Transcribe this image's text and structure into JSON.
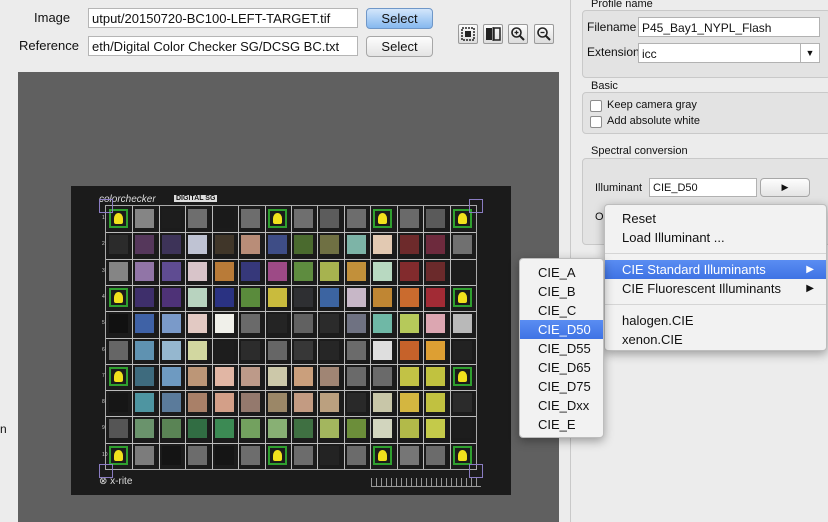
{
  "image_row": {
    "label": "Image",
    "path": "utput/20150720-BC100-LEFT-TARGET.tif",
    "button": "Select"
  },
  "reference_row": {
    "label": "Reference",
    "path": "eth/Digital Color Checker SG/DCSG BC.txt",
    "button": "Select"
  },
  "toolbar": {
    "icons": [
      "fit-icon",
      "compare-icon",
      "zoom-in-icon",
      "zoom-out-icon"
    ]
  },
  "chart": {
    "brand": "colorchecker",
    "brand_badge": "DIGITAL SG",
    "footer_brand": "x-rite",
    "row_numbers": [
      "1",
      "2",
      "3",
      "4",
      "5",
      "6",
      "7",
      "8",
      "9",
      "10"
    ],
    "swatches": [
      [
        "#777777",
        "#858585",
        "#1d1d1d",
        "#6e6e6e",
        "#1a1a1a",
        "#6d6d6d",
        "#1a1a1a",
        "#6f6f6f",
        "#5c5c5c",
        "#6d6d6d",
        "#1b1b1b",
        "#6a6a6a",
        "#5a5a5a",
        "#6f6f6f"
      ],
      [
        "#2b2b2b",
        "#55375b",
        "#3d3358",
        "#bfc3d3",
        "#403629",
        "#b98d78",
        "#3e4d86",
        "#4a6a2e",
        "#6f7043",
        "#7db4a7",
        "#e2c9b2",
        "#6d2a2b",
        "#6d2a3d",
        "#707070"
      ],
      [
        "#858585",
        "#9175a7",
        "#5f4c92",
        "#d8c4c9",
        "#b97b38",
        "#36387a",
        "#9d4a86",
        "#5e8c3f",
        "#a7b34f",
        "#c2903a",
        "#b8d9c1",
        "#822b2d",
        "#6b2a2b",
        "#1c1c1c"
      ],
      [
        "#222222",
        "#3e2f6b",
        "#4e3277",
        "#b8d3bf",
        "#2a3282",
        "#5a8b3c",
        "#c9bb3d",
        "#2e2f32",
        "#3c64a1",
        "#c7b7c7",
        "#c08633",
        "#ca6b2e",
        "#a22b35",
        "#222222"
      ],
      [
        "#111111",
        "#3f62a6",
        "#7a9ac9",
        "#e2c9c3",
        "#f0f0ea",
        "#6a6a6a",
        "#242424",
        "#616161",
        "#2b2b2b",
        "#6f7282",
        "#6fb8a6",
        "#b6c95a",
        "#dca6b1",
        "#b9b9b9"
      ],
      [
        "#666666",
        "#5f92b1",
        "#95b7cf",
        "#d2d7a0",
        "#1d1d1d",
        "#2c2c2c",
        "#666666",
        "#373737",
        "#262626",
        "#6b6b6b",
        "#dedede",
        "#c6622a",
        "#dd9f33",
        "#222222"
      ],
      [
        "#353535",
        "#3e6b7e",
        "#6e9ac1",
        "#bc9677",
        "#e1b6a4",
        "#bd9a89",
        "#ccc8a9",
        "#ca9f7c",
        "#a08574",
        "#6a6a6a",
        "#6a6a6a",
        "#c2c245",
        "#c1c23f",
        "#6f6f6f"
      ],
      [
        "#161616",
        "#4e95a1",
        "#5b7b9b",
        "#a98068",
        "#d39f88",
        "#94796d",
        "#9b8767",
        "#c39b82",
        "#bba07f",
        "#292929",
        "#c8c6a8",
        "#d4b640",
        "#c1c140",
        "#2b2b2b"
      ],
      [
        "#555555",
        "#6a936c",
        "#5a8455",
        "#316d43",
        "#3c8a54",
        "#73a15f",
        "#88b074",
        "#3f7042",
        "#a3b65e",
        "#6c8e3a",
        "#d2d5be",
        "#b2ba49",
        "#c4ca4a",
        "#1d1d1d"
      ],
      [
        "#4b4b4b",
        "#7c7c7c",
        "#141414",
        "#6c6c6c",
        "#151515",
        "#6d6d6d",
        "#1b1b1b",
        "#6c6c6c",
        "#232323",
        "#6b6b6b",
        "#1a1a1a",
        "#767676",
        "#6b6b6b",
        "#6a6a6a"
      ]
    ],
    "bulb_cells": [
      [
        0,
        0
      ],
      [
        0,
        6
      ],
      [
        0,
        10
      ],
      [
        0,
        13
      ],
      [
        3,
        0
      ],
      [
        3,
        13
      ],
      [
        6,
        0
      ],
      [
        6,
        13
      ],
      [
        9,
        0
      ],
      [
        9,
        6
      ],
      [
        9,
        10
      ],
      [
        9,
        13
      ]
    ]
  },
  "left_edge_letter": "n",
  "panel": {
    "profile_name": {
      "title": "Profile name",
      "filename_label": "Filename",
      "filename_value": "P45_Bay1_NYPL_Flash",
      "extension_label": "Extension",
      "extension_value": "icc"
    },
    "basic": {
      "title": "Basic",
      "keep_gray_label": "Keep camera gray",
      "keep_gray_checked": false,
      "absolute_white_label": "Add absolute white",
      "absolute_white_checked": false
    },
    "spectral": {
      "title": "Spectral conversion",
      "illuminant_label": "Illuminant",
      "illuminant_value": "CIE_D50",
      "partial_label": "O"
    }
  },
  "context_menu": {
    "items": [
      {
        "label": "Reset",
        "submenu": false,
        "highlighted": false
      },
      {
        "label": "Load Illuminant ...",
        "submenu": false,
        "highlighted": false
      },
      {
        "label": "CIE Standard Illuminants",
        "submenu": true,
        "highlighted": true
      },
      {
        "label": "CIE Fluorescent Illuminants",
        "submenu": true,
        "highlighted": false
      },
      {
        "label": "halogen.CIE",
        "submenu": false,
        "highlighted": false
      },
      {
        "label": "xenon.CIE",
        "submenu": false,
        "highlighted": false
      }
    ]
  },
  "submenu": {
    "items": [
      "CIE_A",
      "CIE_B",
      "CIE_C",
      "CIE_D50",
      "CIE_D55",
      "CIE_D65",
      "CIE_D75",
      "CIE_Dxx",
      "CIE_E"
    ],
    "highlighted": "CIE_D50"
  }
}
